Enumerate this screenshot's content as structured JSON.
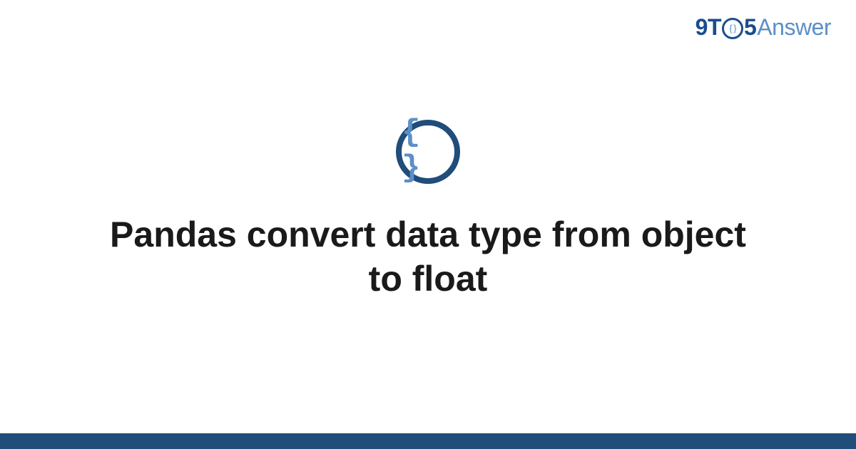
{
  "brand": {
    "part1": "9T",
    "circle_content": "{ }",
    "part2": "5",
    "part3": "Answer"
  },
  "icon": {
    "name": "code-braces-icon",
    "glyph": "{ }"
  },
  "title": "Pandas convert data type from object to float",
  "colors": {
    "brand_primary": "#1a4d8f",
    "brand_secondary": "#5b8fc7",
    "icon_border": "#204d7a",
    "bottom_bar": "#204d7a",
    "text": "#1a1a1a"
  }
}
